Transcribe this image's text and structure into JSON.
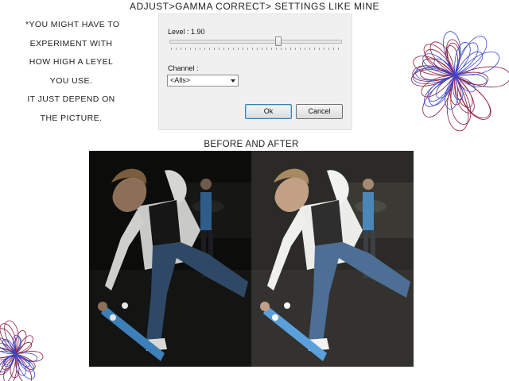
{
  "header": {
    "title": "ADJUST>GAMMA CORRECT> SETTINGS LIKE MINE"
  },
  "note": {
    "lines": [
      "*YOU MIGHT HAVE TO",
      "EXPERIMENT WITH",
      "HOW HIGH A LEYEL",
      "YOU USE.",
      "IT JUST DEPEND ON",
      "THE PICTURE."
    ]
  },
  "dialog": {
    "level_label": "Level : 1.90",
    "level_value": 1.9,
    "channel_label": "Channel :",
    "channel_value": "<Alls>",
    "ok_label": "Ok",
    "cancel_label": "Cancel"
  },
  "photos": {
    "caption": "BEFORE AND AFTER"
  },
  "colors": {
    "scribble_red": "#8b1a3a",
    "scribble_blue": "#3a46d0",
    "ok_border": "#3c7fb1"
  }
}
